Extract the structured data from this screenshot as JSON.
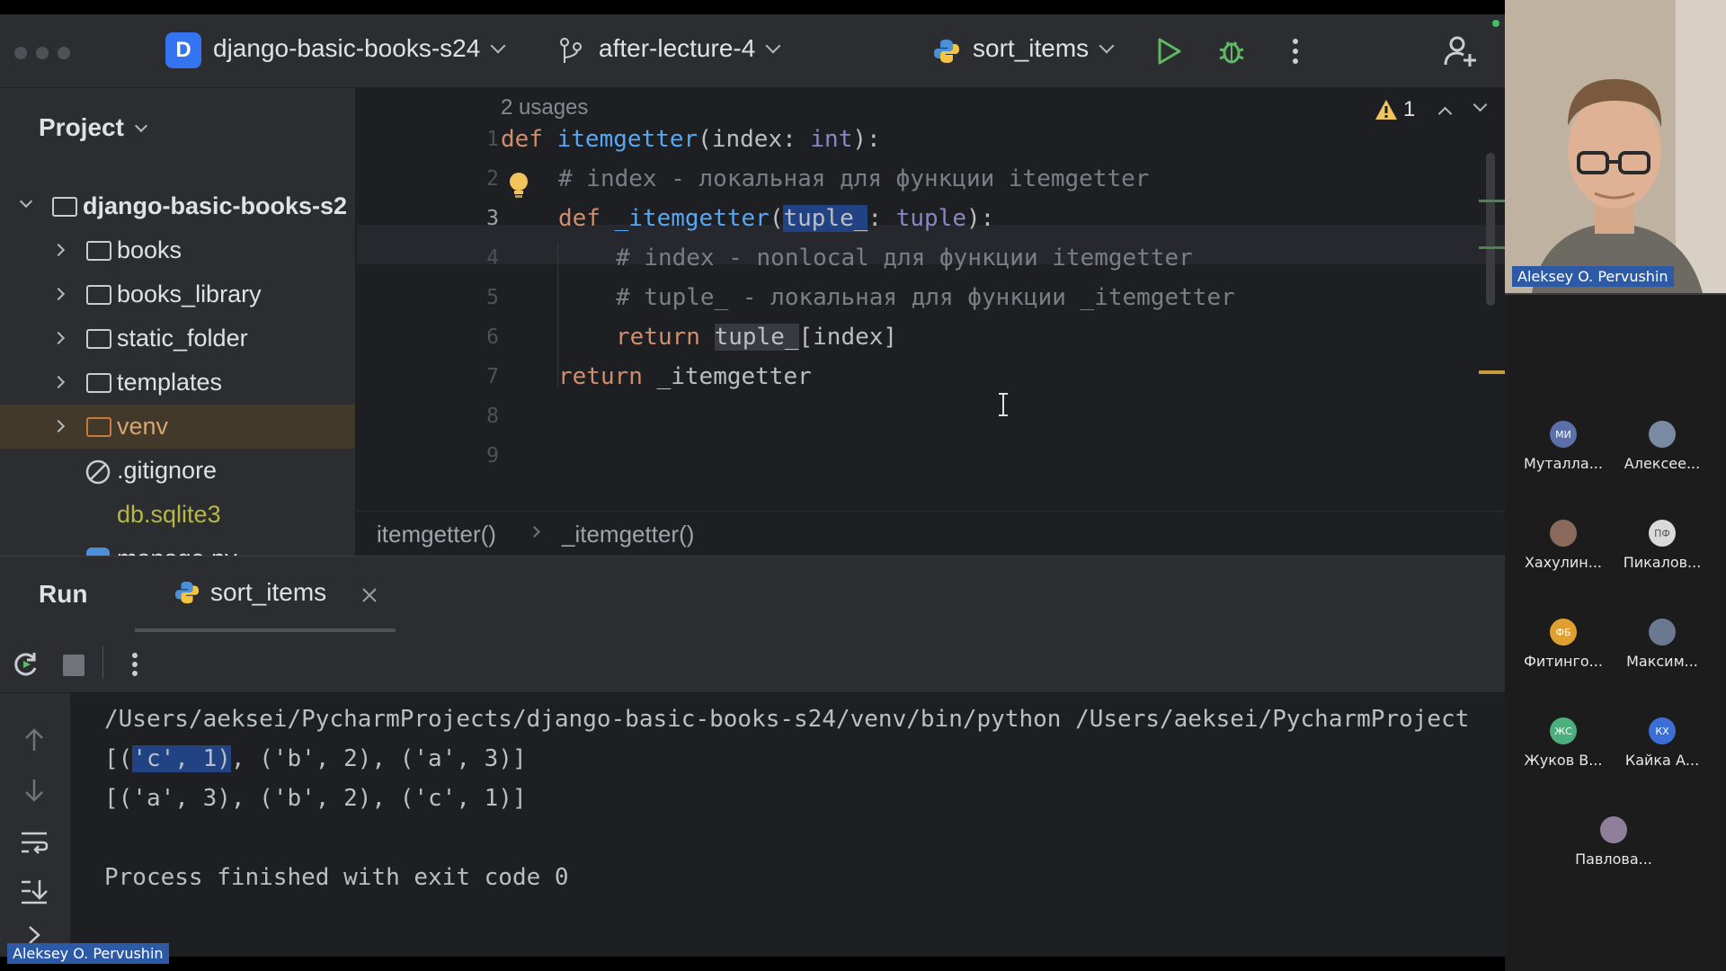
{
  "toolbar": {
    "project_badge": "D",
    "project_name": "django-basic-books-s24",
    "branch": "after-lecture-4",
    "run_config": "sort_items"
  },
  "project_panel": {
    "title": "Project",
    "root": "django-basic-books-s2",
    "items": [
      {
        "label": "books"
      },
      {
        "label": "books_library"
      },
      {
        "label": "static_folder"
      },
      {
        "label": "templates"
      },
      {
        "label": "venv"
      },
      {
        "label": ".gitignore"
      },
      {
        "label": "db.sqlite3"
      },
      {
        "label": "manage.py"
      }
    ]
  },
  "editor": {
    "usages": "2 usages",
    "warnings": "1",
    "line_numbers": [
      "1",
      "2",
      "3",
      "4",
      "5",
      "6",
      "7",
      "8",
      "9"
    ],
    "lines": {
      "l1_def": "def ",
      "l1_name": "itemgetter",
      "l1_open": "(index: ",
      "l1_type": "int",
      "l1_close": "):",
      "l2": "# index - локальная для функции itemgetter",
      "l3_def": "def ",
      "l3_name": "_itemgetter",
      "l3_open": "(",
      "l3_param": "tuple_",
      "l3_colon": ": ",
      "l3_type": "tuple",
      "l3_close": "):",
      "l4": "# index - nonlocal для функции itemgetter",
      "l5": "# tuple_ - локальная для функции _itemgetter",
      "l6_ret": "return ",
      "l6_var": "tuple_",
      "l6_rest": "[index]",
      "l7_ret": "return ",
      "l7_rest": "_itemgetter"
    },
    "breadcrumb": [
      "itemgetter()",
      "_itemgetter()"
    ]
  },
  "run_panel": {
    "tab_run": "Run",
    "tab_config": "sort_items",
    "output": {
      "cmd": "/Users/aeksei/PycharmProjects/django-basic-books-s24/venv/bin/python /Users/aeksei/PycharmProject",
      "line1_a": "[(",
      "line1_hl": "'c', 1)",
      "line1_b": ", ('b', 2), ('a', 3)]",
      "line2": "[('a', 3), ('b', 2), ('c', 1)]",
      "finished": "Process finished with exit code 0"
    }
  },
  "zoom": {
    "speaker_name": "Aleksey O. Pervushin",
    "participants": [
      {
        "initials": "МИ",
        "name": "Муталла...",
        "color": "#5b6fa8"
      },
      {
        "initials": "",
        "name": "Алексее...",
        "color": "#7a8aa3"
      },
      {
        "initials": "",
        "name": "Хахулин...",
        "color": "#8a6a5a"
      },
      {
        "initials": "ПФ",
        "name": "Пикалов...",
        "color": "#d9d9d9"
      },
      {
        "initials": "ФБ",
        "name": "Фитинго...",
        "color": "#e0a030"
      },
      {
        "initials": "",
        "name": "Максим...",
        "color": "#6a7890"
      },
      {
        "initials": "ЖС",
        "name": "Жуков В...",
        "color": "#4caf7d"
      },
      {
        "initials": "КХ",
        "name": "Кайка А...",
        "color": "#3b6fd6"
      },
      {
        "initials": "",
        "name": "Павлова...",
        "color": "#8f7f9a"
      }
    ]
  },
  "bottom_label": "Aleksey O. Pervushin"
}
